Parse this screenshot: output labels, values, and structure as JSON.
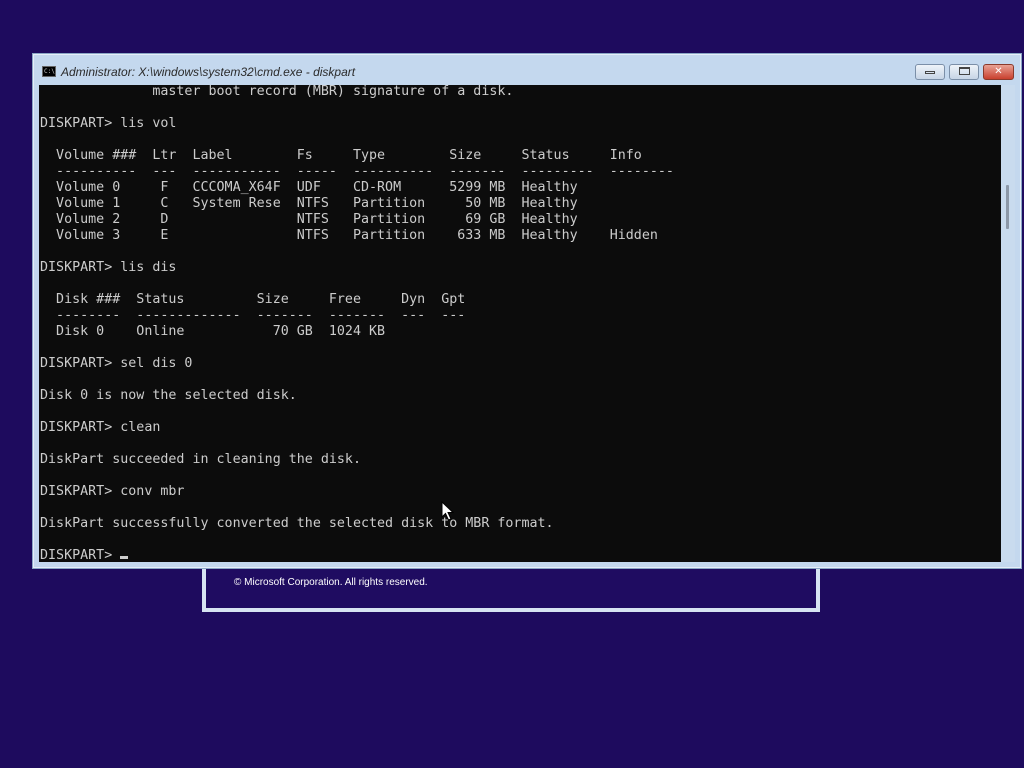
{
  "window": {
    "title": "Administrator: X:\\windows\\system32\\cmd.exe - diskpart",
    "icon": "cmd-icon",
    "icon_glyph": "C:\\",
    "buttons": {
      "minimize": "minimize-icon",
      "maximize": "maximize-icon",
      "close": "close-icon",
      "close_glyph": "✕"
    }
  },
  "console": {
    "lines": [
      "              master boot record (MBR) signature of a disk.",
      "",
      "DISKPART> lis vol",
      "",
      "  Volume ###  Ltr  Label        Fs     Type        Size     Status     Info",
      "  ----------  ---  -----------  -----  ----------  -------  ---------  --------",
      "  Volume 0     F   CCCOMA_X64F  UDF    CD-ROM      5299 MB  Healthy",
      "  Volume 1     C   System Rese  NTFS   Partition     50 MB  Healthy",
      "  Volume 2     D                NTFS   Partition     69 GB  Healthy",
      "  Volume 3     E                NTFS   Partition    633 MB  Healthy    Hidden",
      "",
      "DISKPART> lis dis",
      "",
      "  Disk ###  Status         Size     Free     Dyn  Gpt",
      "  --------  -------------  -------  -------  ---  ---",
      "  Disk 0    Online           70 GB  1024 KB",
      "",
      "DISKPART> sel dis 0",
      "",
      "Disk 0 is now the selected disk.",
      "",
      "DISKPART> clean",
      "",
      "DiskPart succeeded in cleaning the disk.",
      "",
      "DISKPART> conv mbr",
      "",
      "DiskPart successfully converted the selected disk to MBR format.",
      ""
    ],
    "prompt": "DISKPART> "
  },
  "setup_window": {
    "copyright": "© Microsoft Corporation. All rights reserved."
  },
  "colors": {
    "desktop": "#1e0b5e",
    "console_bg": "#0c0c0c",
    "console_fg": "#cccccc",
    "window_frame": "#c4d8ee",
    "close_button": "#c9402e"
  }
}
